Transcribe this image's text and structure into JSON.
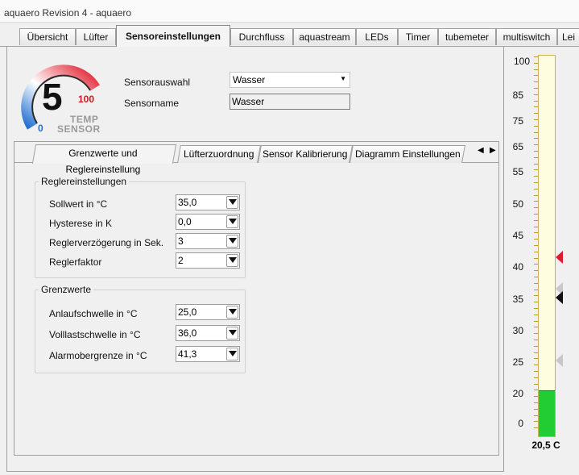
{
  "window": {
    "title": "aquaero Revision 4 -  aquaero"
  },
  "tabs": [
    {
      "label": "Übersicht"
    },
    {
      "label": "Lüfter"
    },
    {
      "label": "Sensoreinstellungen"
    },
    {
      "label": "Durchfluss"
    },
    {
      "label": "aquastream"
    },
    {
      "label": "LEDs"
    },
    {
      "label": "Timer"
    },
    {
      "label": "tubemeter"
    },
    {
      "label": "multiswitch"
    },
    {
      "label": "Lei"
    }
  ],
  "gauge": {
    "number": "5",
    "min": "0",
    "max": "100",
    "caption_line1": "TEMP",
    "caption_line2": "SENSOR",
    "colors": {
      "cold": "#1f6fd1",
      "hot": "#e01a2a"
    }
  },
  "sensor": {
    "select_label": "Sensorauswahl",
    "select_value": "Wasser",
    "name_label": "Sensorname",
    "name_value": "Wasser"
  },
  "inner_tabs": [
    {
      "label": "Grenzwerte und Reglereinstellung"
    },
    {
      "label": "Lüfterzuordnung"
    },
    {
      "label": "Sensor Kalibrierung"
    },
    {
      "label": "Diagramm Einstellungen"
    }
  ],
  "controller_group": {
    "title": "Reglereinstellungen",
    "fields": [
      {
        "label": "Sollwert in °C",
        "value": "35,0"
      },
      {
        "label": "Hysterese in K",
        "value": "0,0"
      },
      {
        "label": "Reglerverzögerung in Sek.",
        "value": "3"
      },
      {
        "label": "Reglerfaktor",
        "value": "2"
      }
    ]
  },
  "limits_group": {
    "title": "Grenzwerte",
    "fields": [
      {
        "label": "Anlaufschwelle in °C",
        "value": "25,0"
      },
      {
        "label": "Volllastschwelle in °C",
        "value": "36,0"
      },
      {
        "label": "Alarmobergrenze in °C",
        "value": "41,3"
      }
    ]
  },
  "thermometer": {
    "scale_labels": [
      "100",
      "85",
      "75",
      "65",
      "55",
      "50",
      "45",
      "40",
      "35",
      "30",
      "25",
      "20",
      "0"
    ],
    "current": "20,5 C",
    "fill_fraction": 0.12,
    "colors": {
      "fill": "#22cc33",
      "alarm_marker": "#e01a2a",
      "setpoint_marker": "#111111",
      "threshold_marker": "#c8c8c8"
    }
  }
}
